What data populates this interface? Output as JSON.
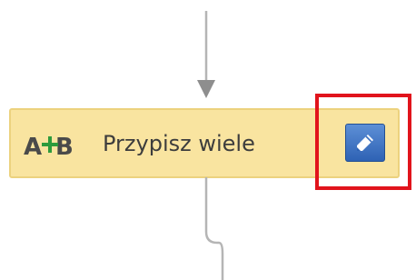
{
  "step": {
    "label": "Przypisz wiele",
    "icon": "assign-ab-icon",
    "action_icon": "pencil-icon"
  },
  "colors": {
    "step_fill": "#f9e4a0",
    "step_border": "#ecd27e",
    "edit_button": "#3a6fc0",
    "highlight": "#e1141c",
    "connector": "#b5b5b5"
  }
}
